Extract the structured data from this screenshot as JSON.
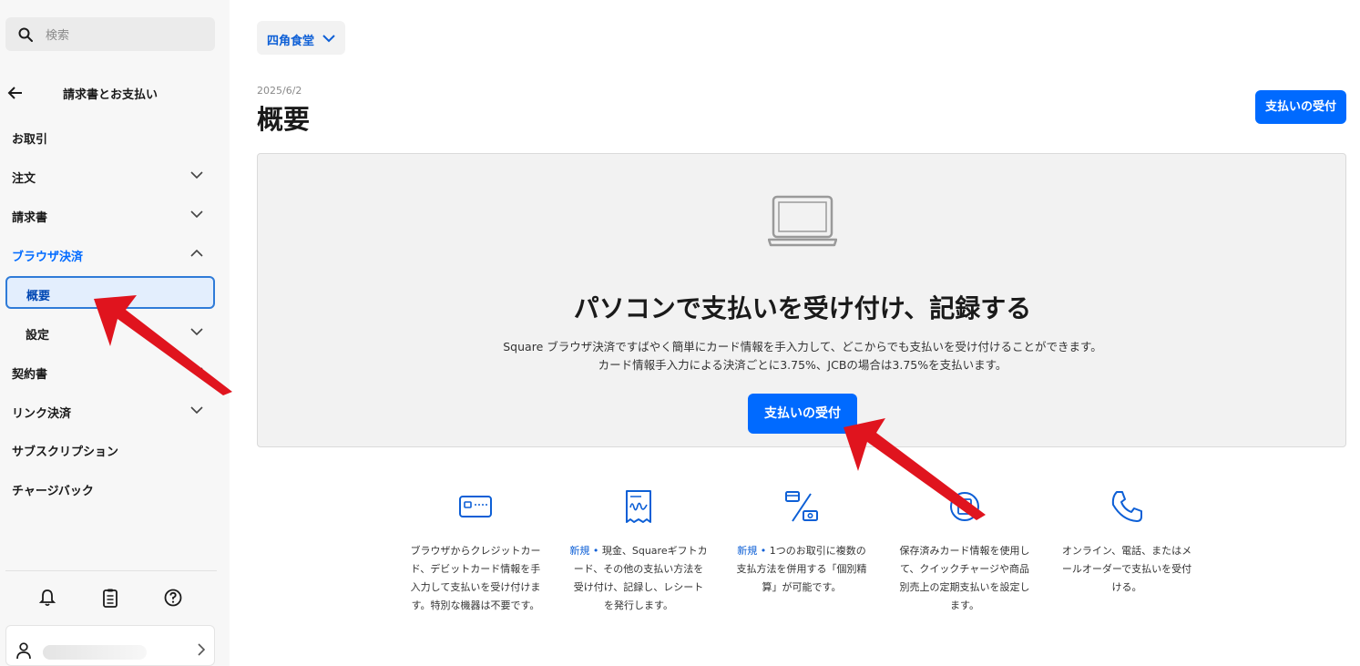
{
  "sidebar": {
    "search_placeholder": "検索",
    "back_title": "請求書とお支払い",
    "items": [
      {
        "label": "お取引"
      },
      {
        "label": "注文"
      },
      {
        "label": "請求書"
      },
      {
        "label": "ブラウザ決済"
      },
      {
        "label": "概要"
      },
      {
        "label": "設定"
      },
      {
        "label": "契約書"
      },
      {
        "label": "リンク決済"
      },
      {
        "label": "サブスクリプション"
      },
      {
        "label": "チャージバック"
      }
    ],
    "bottom_icons": [
      "bell-icon",
      "clipboard-icon",
      "help-icon"
    ]
  },
  "header": {
    "location": "四角食堂",
    "date": "2025/6/2",
    "title": "概要",
    "accept_button": "支払いの受付"
  },
  "hero": {
    "icon": "laptop-icon",
    "title": "パソコンで支払いを受け付け、記録する",
    "desc_line1": "Square ブラウザ決済ですばやく簡単にカード情報を手入力して、どこからでも支払いを受け付けることができます。",
    "desc_line2": "カード情報手入力による決済ごとに3.75%、JCBの場合は3.75%を支払います。",
    "button": "支払いの受付"
  },
  "features": [
    {
      "icon": "card-icon",
      "new": "",
      "lines": [
        "ブラウザからクレジットカー",
        "ド、デビットカード情報を手",
        "入力して支払いを受け付けま",
        "す。特別な機器は不要です。"
      ]
    },
    {
      "icon": "receipt-icon",
      "new": "新規 •",
      "lines": [
        " 現金、Squareギフトカ",
        "ード、その他の支払い方法を",
        "受け付け、記録し、レシート",
        "を発行します。"
      ]
    },
    {
      "icon": "split-payment-icon",
      "new": "新規 •",
      "lines": [
        " 1つのお取引に複数の",
        "支払方法を併用する「個別精",
        "算」が可能です。"
      ]
    },
    {
      "icon": "recurring-card-icon",
      "new": "",
      "lines": [
        "保存済みカード情報を使用し",
        "て、クイックチャージや商品",
        "別売上の定期支払いを設定し",
        "ます。"
      ]
    },
    {
      "icon": "phone-icon",
      "new": "",
      "lines": [
        "オンライン、電話、またはメ",
        "ールオーダーで支払いを受付",
        "ける。"
      ]
    }
  ],
  "colors": {
    "accent": "#006aff",
    "annotation_arrow": "#e0141e"
  }
}
